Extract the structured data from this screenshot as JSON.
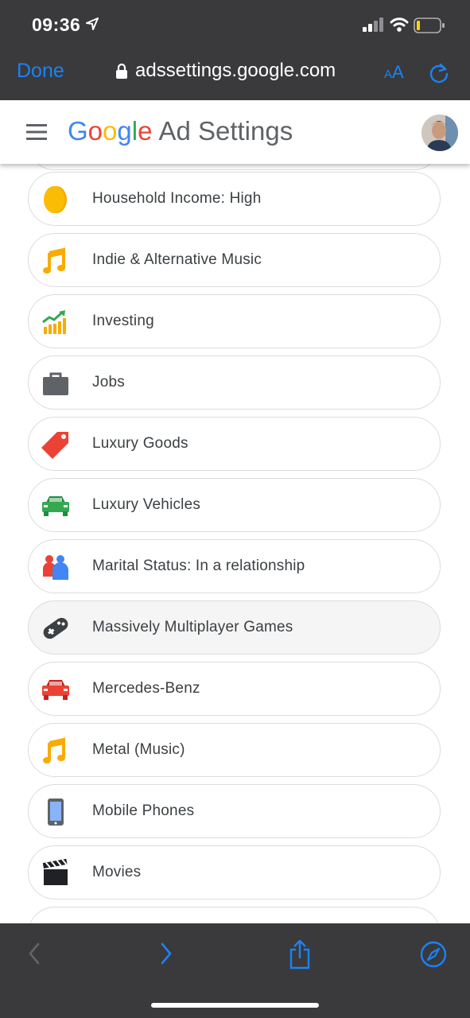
{
  "status": {
    "time": "09:36"
  },
  "browser": {
    "done_label": "Done",
    "url": "adssettings.google.com",
    "aa_small": "A",
    "aa_large": "A"
  },
  "header": {
    "logo": [
      "G",
      "o",
      "o",
      "g",
      "l",
      "e"
    ],
    "title": "Ad Settings"
  },
  "items": [
    {
      "label": "Household Income: High",
      "icon": "coin-icon"
    },
    {
      "label": "Indie & Alternative Music",
      "icon": "music-note-icon"
    },
    {
      "label": "Investing",
      "icon": "investing-chart-icon"
    },
    {
      "label": "Jobs",
      "icon": "briefcase-icon"
    },
    {
      "label": "Luxury Goods",
      "icon": "price-tag-icon"
    },
    {
      "label": "Luxury Vehicles",
      "icon": "car-icon"
    },
    {
      "label": "Marital Status: In a relationship",
      "icon": "couple-icon"
    },
    {
      "label": "Massively Multiplayer Games",
      "icon": "gamepad-icon"
    },
    {
      "label": "Mercedes-Benz",
      "icon": "car-icon"
    },
    {
      "label": "Metal (Music)",
      "icon": "music-note-icon"
    },
    {
      "label": "Mobile Phones",
      "icon": "mobile-phone-icon"
    },
    {
      "label": "Movies",
      "icon": "clapperboard-icon"
    }
  ],
  "colors": {
    "accent": "#1a82f7",
    "chrome": "#3a3a3c"
  }
}
